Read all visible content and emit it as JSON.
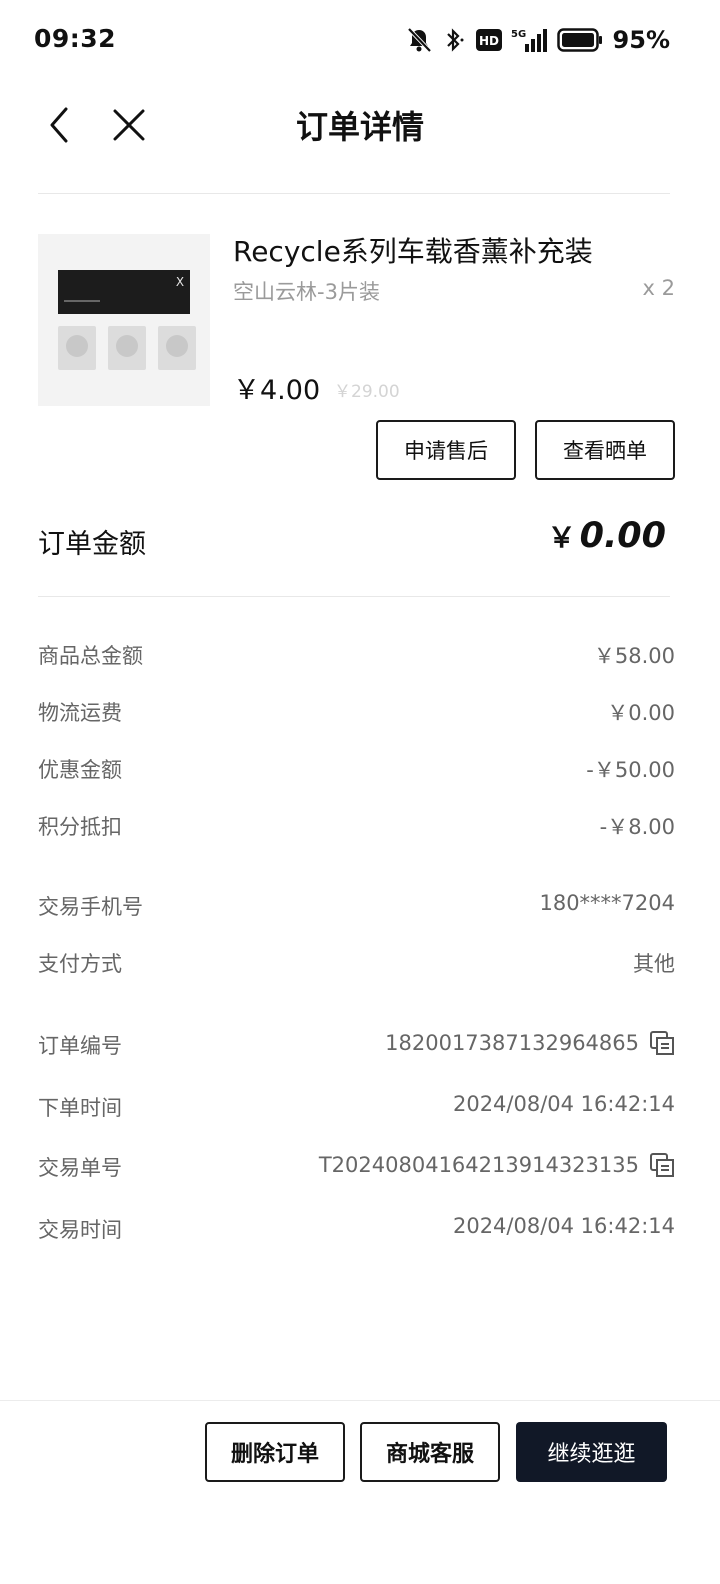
{
  "status_bar": {
    "time": "09:32",
    "network_label": "5G",
    "hd_label": "HD",
    "battery": "95%"
  },
  "header": {
    "title": "订单详情"
  },
  "product": {
    "name": "Recycle系列车载香薰补充装",
    "variant": "空山云林-3片装",
    "quantity": "x 2",
    "price": "￥4.00",
    "original_price": "￥29.00",
    "after_sale_label": "申请售后",
    "view_review_label": "查看晒单"
  },
  "order_total": {
    "label": "订单金额",
    "currency": "￥",
    "value": "0.00"
  },
  "amounts": [
    {
      "key": "商品总金额",
      "value": "￥58.00"
    },
    {
      "key": "物流运费",
      "value": "￥0.00"
    },
    {
      "key": "优惠金额",
      "value": "-￥50.00"
    },
    {
      "key": "积分抵扣",
      "value": "-￥8.00"
    }
  ],
  "payment": [
    {
      "key": "交易手机号",
      "value": "180****7204"
    },
    {
      "key": "支付方式",
      "value": "其他"
    }
  ],
  "order_info": [
    {
      "key": "订单编号",
      "value": "1820017387132964865"
    },
    {
      "key": "下单时间",
      "value": "2024/08/04 16:42:14"
    },
    {
      "key": "交易单号",
      "value": "T202408041642139143231​35"
    },
    {
      "key": "交易时间",
      "value": "2024/08/04 16:42:14"
    }
  ],
  "actions": {
    "delete_label": "删除订单",
    "service_label": "商城客服",
    "continue_label": "继续逛逛"
  },
  "colors": {
    "primary_button": "#111827",
    "muted_text": "#666666",
    "divider": "#e8e8e8"
  }
}
